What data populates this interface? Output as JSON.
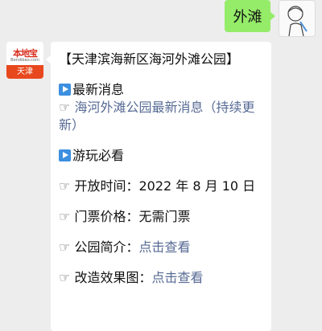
{
  "outgoing": {
    "text": "外滩"
  },
  "incoming_avatar": {
    "brand": "本地宝",
    "sub": "Bendibao.com",
    "city": "天津"
  },
  "message": {
    "title": "【天津滨海新区海河外滩公园】",
    "latest_label": "最新消息",
    "latest_link": "海河外滩公园最新消息（持续更新）",
    "play_label": "游玩必看",
    "open_label": "开放时间：",
    "open_value": "2022 年 8 月 10 日",
    "ticket_label": "门票价格：",
    "ticket_value": "无需门票",
    "intro_label": "公园简介：",
    "intro_link": "点击查看",
    "effect_label": "改造效果图：",
    "effect_link": "点击查看"
  }
}
